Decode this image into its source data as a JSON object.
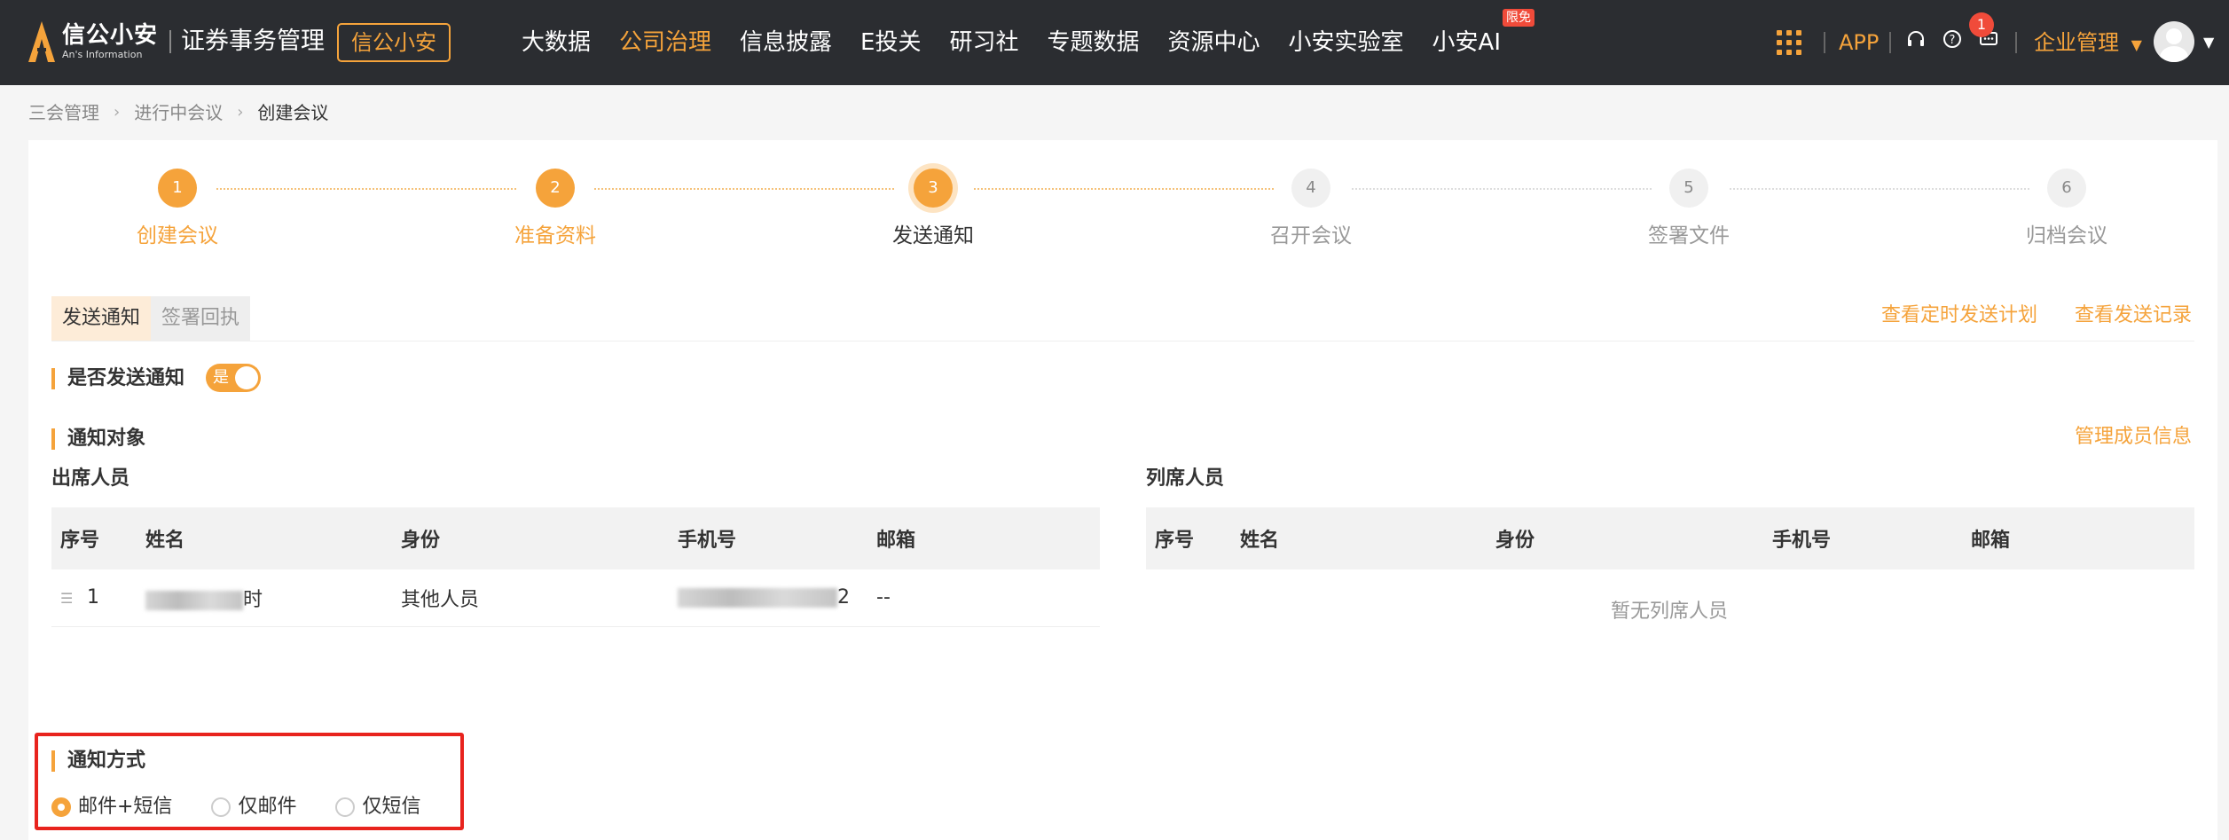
{
  "header": {
    "logo_cn": "信公小安",
    "logo_en": "An's Information",
    "app_name": "证券事务管理",
    "brand_button": "信公小安",
    "nav": [
      {
        "label": "大数据",
        "active": false
      },
      {
        "label": "公司治理",
        "active": true
      },
      {
        "label": "信息披露",
        "active": false
      },
      {
        "label": "E投关",
        "active": false
      },
      {
        "label": "研习社",
        "active": false
      },
      {
        "label": "专题数据",
        "active": false
      },
      {
        "label": "资源中心",
        "active": false
      },
      {
        "label": "小安实验室",
        "active": false
      },
      {
        "label": "小安AI",
        "active": false,
        "badge": "限免"
      }
    ],
    "app_link": "APP",
    "message_count": "1",
    "enterprise_menu": "企业管理",
    "icons": [
      "apps-grid-icon",
      "headset-icon",
      "help-icon",
      "message-icon",
      "avatar",
      "chevron-down-icon"
    ],
    "accent_color": "#f5a33b"
  },
  "breadcrumb": [
    "三会管理",
    "进行中会议",
    "创建会议"
  ],
  "steps": [
    {
      "number": "1",
      "label": "创建会议",
      "state": "done"
    },
    {
      "number": "2",
      "label": "准备资料",
      "state": "done"
    },
    {
      "number": "3",
      "label": "发送通知",
      "state": "current"
    },
    {
      "number": "4",
      "label": "召开会议",
      "state": "todo"
    },
    {
      "number": "5",
      "label": "签署文件",
      "state": "todo"
    },
    {
      "number": "6",
      "label": "归档会议",
      "state": "todo"
    }
  ],
  "tabs": [
    "发送通知",
    "签署回执"
  ],
  "links": {
    "scheduled_plan": "查看定时发送计划",
    "send_record": "查看发送记录",
    "manage_members": "管理成员信息"
  },
  "send_notice": {
    "label": "是否发送通知",
    "toggle_text": "是",
    "enabled": true
  },
  "notice_target": {
    "title": "通知对象",
    "attendees": {
      "title": "出席人员",
      "columns": [
        "序号",
        "姓名",
        "身份",
        "手机号",
        "邮箱"
      ],
      "rows": [
        {
          "index": "1",
          "name_suffix": "时",
          "identity": "其他人员",
          "phone_suffix": "2",
          "email": "--"
        }
      ]
    },
    "observers": {
      "title": "列席人员",
      "columns": [
        "序号",
        "姓名",
        "身份",
        "手机号",
        "邮箱"
      ],
      "empty_text": "暂无列席人员"
    }
  },
  "notice_method": {
    "title": "通知方式",
    "options": [
      {
        "label": "邮件+短信",
        "selected": true
      },
      {
        "label": "仅邮件",
        "selected": false
      },
      {
        "label": "仅短信",
        "selected": false
      }
    ]
  }
}
